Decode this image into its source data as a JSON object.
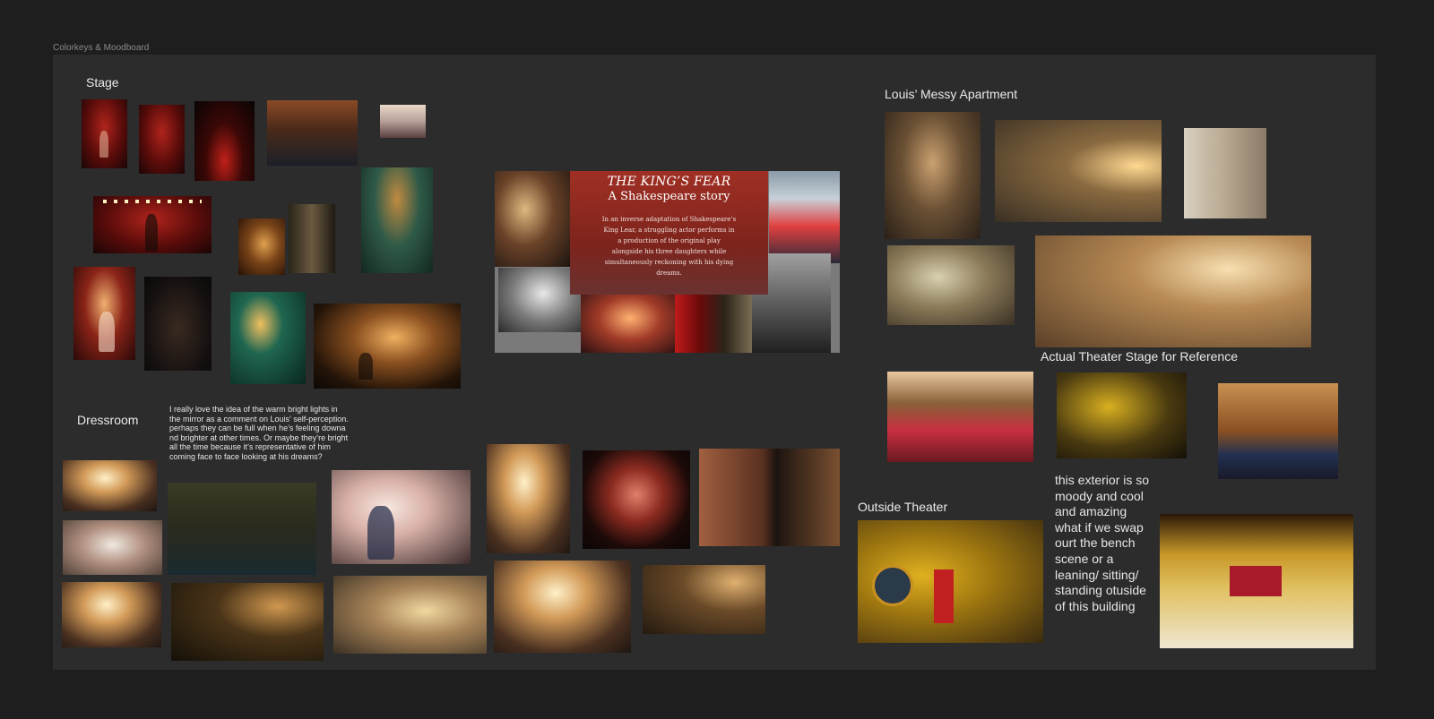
{
  "frame": {
    "label": "Colorkeys & Moodboard"
  },
  "sections": {
    "stage": "Stage",
    "dressroom": "Dressroom",
    "apartment": "Louis’ Messy Apartment",
    "actual_theater": "Actual Theater Stage for Reference",
    "outside": "Outside Theater"
  },
  "notes": {
    "dressroom_note": "I really love the idea of the warm bright lights in the mirror as a comment on Louis’ self-perception. perhaps they can be full when he’s feeling downa nd brighter at other times. Or maybe they’re bright all the time because it’s representative of him coming face to face looking at his dreams?",
    "outside_note": "this exterior is so moody and cool and amazing what if we swap ourt the bench scene or a leaning/ sitting/ standing otuside of this building"
  },
  "poster": {
    "title": "THE KING’S FEAR",
    "subtitle": "A Shakespeare story",
    "description": "In an inverse adaptation of Shakespeare’s King Lear, a struggling actor performs in a production of the original play alongside his three daughters while simultaneously reckoning with his dying dreams."
  }
}
